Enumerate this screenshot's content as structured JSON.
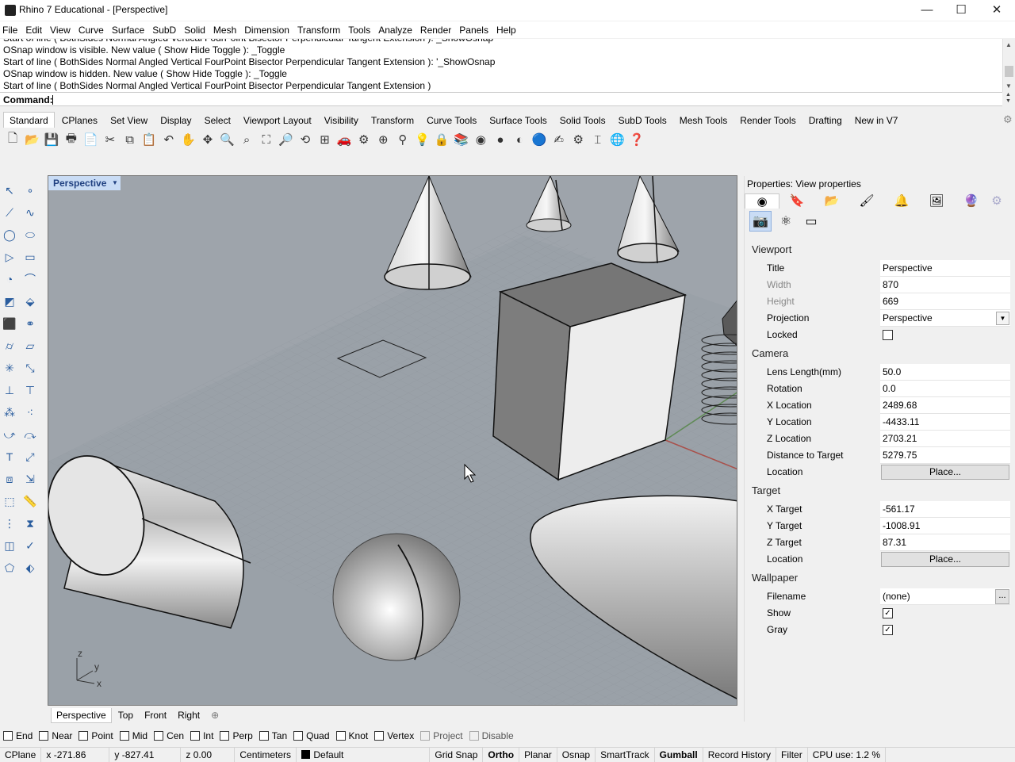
{
  "window": {
    "title": "Rhino 7 Educational - [Perspective]",
    "minimize": "—",
    "maximize": "☐",
    "close": "✕"
  },
  "menu": [
    "File",
    "Edit",
    "View",
    "Curve",
    "Surface",
    "SubD",
    "Solid",
    "Mesh",
    "Dimension",
    "Transform",
    "Tools",
    "Analyze",
    "Render",
    "Panels",
    "Help"
  ],
  "command_history": [
    "Start of line ( BothSides  Normal  Angled  Vertical  FourPoint  Bisector  Perpendicular  Tangent  Extension ): _ShowOsnap",
    "OSnap window is visible. New value ( Show  Hide  Toggle ): _Toggle",
    "Start of line ( BothSides  Normal  Angled  Vertical  FourPoint  Bisector  Perpendicular  Tangent  Extension ): '_ShowOsnap",
    "OSnap window is hidden. New value ( Show  Hide  Toggle ): _Toggle",
    "Start of line ( BothSides  Normal  Angled  Vertical  FourPoint  Bisector  Perpendicular  Tangent  Extension )"
  ],
  "command_label": "Command:",
  "toolbar_tabs": [
    "Standard",
    "CPlanes",
    "Set View",
    "Display",
    "Select",
    "Viewport Layout",
    "Visibility",
    "Transform",
    "Curve Tools",
    "Surface Tools",
    "Solid Tools",
    "SubD Tools",
    "Mesh Tools",
    "Render Tools",
    "Drafting",
    "New in V7"
  ],
  "main_toolbar_icons": [
    {
      "name": "new-icon",
      "glyph": "🗋"
    },
    {
      "name": "open-icon",
      "glyph": "📂"
    },
    {
      "name": "save-icon",
      "glyph": "💾"
    },
    {
      "name": "print-icon",
      "glyph": "🖶"
    },
    {
      "name": "import-icon",
      "glyph": "📄"
    },
    {
      "name": "cut-icon",
      "glyph": "✂"
    },
    {
      "name": "copy-icon",
      "glyph": "⧉"
    },
    {
      "name": "paste-icon",
      "glyph": "📋"
    },
    {
      "name": "undo-icon",
      "glyph": "↶"
    },
    {
      "name": "pan-icon",
      "glyph": "✋"
    },
    {
      "name": "rotate-view-icon",
      "glyph": "✥"
    },
    {
      "name": "zoom-icon",
      "glyph": "🔍"
    },
    {
      "name": "zoom-window-icon",
      "glyph": "⌕"
    },
    {
      "name": "zoom-extents-icon",
      "glyph": "⛶"
    },
    {
      "name": "zoom-selected-icon",
      "glyph": "🔎"
    },
    {
      "name": "undo-view-icon",
      "glyph": "⟲"
    },
    {
      "name": "four-viewports-icon",
      "glyph": "⊞"
    },
    {
      "name": "car-icon",
      "glyph": "🚗"
    },
    {
      "name": "object-props-icon",
      "glyph": "⚙"
    },
    {
      "name": "cplane-icon",
      "glyph": "⊕"
    },
    {
      "name": "snap-icon",
      "glyph": "⚲"
    },
    {
      "name": "light-icon",
      "glyph": "💡"
    },
    {
      "name": "lock-icon",
      "glyph": "🔒"
    },
    {
      "name": "layer-icon",
      "glyph": "📚"
    },
    {
      "name": "color-wheel-icon",
      "glyph": "◉"
    },
    {
      "name": "render-sphere-icon",
      "glyph": "●"
    },
    {
      "name": "shaded-sphere-icon",
      "glyph": "◐"
    },
    {
      "name": "material-sphere-icon",
      "glyph": "🔵"
    },
    {
      "name": "pointer-icon",
      "glyph": "✍"
    },
    {
      "name": "options-icon",
      "glyph": "⚙"
    },
    {
      "name": "dimension-icon",
      "glyph": "⌶"
    },
    {
      "name": "globe-icon",
      "glyph": "🌐"
    },
    {
      "name": "help-icon",
      "glyph": "❓"
    }
  ],
  "left_toolbar_icons": [
    {
      "name": "select-arrow-icon",
      "glyph": "↖"
    },
    {
      "name": "point-icon",
      "glyph": "∘"
    },
    {
      "name": "polyline-icon",
      "glyph": "⟋"
    },
    {
      "name": "curve-icon",
      "glyph": "∿"
    },
    {
      "name": "circle-icon",
      "glyph": "◯"
    },
    {
      "name": "ellipse-icon",
      "glyph": "⬭"
    },
    {
      "name": "polygon-icon",
      "glyph": "▷"
    },
    {
      "name": "rectangle-icon",
      "glyph": "▭"
    },
    {
      "name": "arc-icon",
      "glyph": "◔"
    },
    {
      "name": "fillet-icon",
      "glyph": "⌒"
    },
    {
      "name": "surface-icon",
      "glyph": "◩"
    },
    {
      "name": "extrude-icon",
      "glyph": "⬙"
    },
    {
      "name": "box-icon",
      "glyph": "⬛"
    },
    {
      "name": "boolean-icon",
      "glyph": "⚭"
    },
    {
      "name": "cylinder-icon",
      "glyph": "⌭"
    },
    {
      "name": "plane-surface-icon",
      "glyph": "▱"
    },
    {
      "name": "transform-icon",
      "glyph": "✳"
    },
    {
      "name": "scale-icon",
      "glyph": "⤡"
    },
    {
      "name": "split-icon",
      "glyph": "⊥"
    },
    {
      "name": "join-icon",
      "glyph": "⊤"
    },
    {
      "name": "group-icon",
      "glyph": "⁂"
    },
    {
      "name": "explode-icon",
      "glyph": "⁖"
    },
    {
      "name": "dimension-icon",
      "glyph": "⤻"
    },
    {
      "name": "leader-icon",
      "glyph": "⤼"
    },
    {
      "name": "text-icon",
      "glyph": "T"
    },
    {
      "name": "hatch-icon",
      "glyph": "⤢"
    },
    {
      "name": "array-icon",
      "glyph": "⧈"
    },
    {
      "name": "align-icon",
      "glyph": "⇲"
    },
    {
      "name": "mesh-icon",
      "glyph": "⬚"
    },
    {
      "name": "measure-icon",
      "glyph": "📏"
    },
    {
      "name": "grid-array-icon",
      "glyph": "⋮"
    },
    {
      "name": "history-icon",
      "glyph": "⧗"
    },
    {
      "name": "analyze-icon",
      "glyph": "◫"
    },
    {
      "name": "check-icon",
      "glyph": "✓"
    },
    {
      "name": "shape-icon",
      "glyph": "⬠"
    },
    {
      "name": "paint-icon",
      "glyph": "⬖"
    }
  ],
  "viewport": {
    "label": "Perspective",
    "axes": {
      "z": "z",
      "y": "y",
      "x": "x"
    }
  },
  "viewport_tabs": [
    "Perspective",
    "Top",
    "Front",
    "Right"
  ],
  "viewport_tab_add": "⊕",
  "properties": {
    "title": "Properties: View properties",
    "tab_icons": [
      {
        "name": "viewport-props-icon",
        "glyph": "◉"
      },
      {
        "name": "material-icon",
        "glyph": "🔖"
      },
      {
        "name": "folder-icon",
        "glyph": "📂"
      },
      {
        "name": "brush-icon",
        "glyph": "🖌"
      },
      {
        "name": "bell-icon",
        "glyph": "🔔"
      },
      {
        "name": "image-icon",
        "glyph": "🖼"
      },
      {
        "name": "render-icon",
        "glyph": "🔮"
      },
      {
        "name": "settings-icon",
        "glyph": "⚙"
      }
    ],
    "sub_icons": [
      {
        "name": "camera-icon",
        "glyph": "📷"
      },
      {
        "name": "molecule-icon",
        "glyph": "⚛"
      },
      {
        "name": "frame-icon",
        "glyph": "▭"
      }
    ],
    "sections": {
      "viewport": "Viewport",
      "camera": "Camera",
      "target": "Target",
      "wallpaper": "Wallpaper"
    },
    "fields": {
      "title": {
        "label": "Title",
        "value": "Perspective"
      },
      "width": {
        "label": "Width",
        "value": "870"
      },
      "height": {
        "label": "Height",
        "value": "669"
      },
      "projection": {
        "label": "Projection",
        "value": "Perspective"
      },
      "locked": {
        "label": "Locked",
        "checked": false
      },
      "lens": {
        "label": "Lens Length(mm)",
        "value": "50.0"
      },
      "rotation": {
        "label": "Rotation",
        "value": "0.0"
      },
      "xloc": {
        "label": "X Location",
        "value": "2489.68"
      },
      "yloc": {
        "label": "Y Location",
        "value": "-4433.11"
      },
      "zloc": {
        "label": "Z Location",
        "value": "2703.21"
      },
      "dist": {
        "label": "Distance to Target",
        "value": "5279.75"
      },
      "cam_location": {
        "label": "Location",
        "button": "Place..."
      },
      "xtarget": {
        "label": "X Target",
        "value": "-561.17"
      },
      "ytarget": {
        "label": "Y Target",
        "value": "-1008.91"
      },
      "ztarget": {
        "label": "Z Target",
        "value": "87.31"
      },
      "tgt_location": {
        "label": "Location",
        "button": "Place..."
      },
      "filename": {
        "label": "Filename",
        "value": "(none)",
        "button": "..."
      },
      "show": {
        "label": "Show",
        "checked": true
      },
      "gray": {
        "label": "Gray",
        "checked": true
      }
    }
  },
  "osnap": [
    {
      "label": "End",
      "checked": false
    },
    {
      "label": "Near",
      "checked": false
    },
    {
      "label": "Point",
      "checked": false
    },
    {
      "label": "Mid",
      "checked": false
    },
    {
      "label": "Cen",
      "checked": false
    },
    {
      "label": "Int",
      "checked": false
    },
    {
      "label": "Perp",
      "checked": false
    },
    {
      "label": "Tan",
      "checked": false
    },
    {
      "label": "Quad",
      "checked": false
    },
    {
      "label": "Knot",
      "checked": false
    },
    {
      "label": "Vertex",
      "checked": false
    },
    {
      "label": "Project",
      "checked": false,
      "disabled": true
    },
    {
      "label": "Disable",
      "checked": false,
      "disabled": true
    }
  ],
  "status": {
    "cplane": "CPlane",
    "x": "x -271.86",
    "y": "y -827.41",
    "z": "z 0.00",
    "units": "Centimeters",
    "layer": "Default",
    "toggles": [
      {
        "label": "Grid Snap",
        "bold": false
      },
      {
        "label": "Ortho",
        "bold": true
      },
      {
        "label": "Planar",
        "bold": false
      },
      {
        "label": "Osnap",
        "bold": false
      },
      {
        "label": "SmartTrack",
        "bold": false
      },
      {
        "label": "Gumball",
        "bold": true
      },
      {
        "label": "Record History",
        "bold": false
      },
      {
        "label": "Filter",
        "bold": false
      }
    ],
    "cpu": "CPU use: 1.2 %"
  }
}
